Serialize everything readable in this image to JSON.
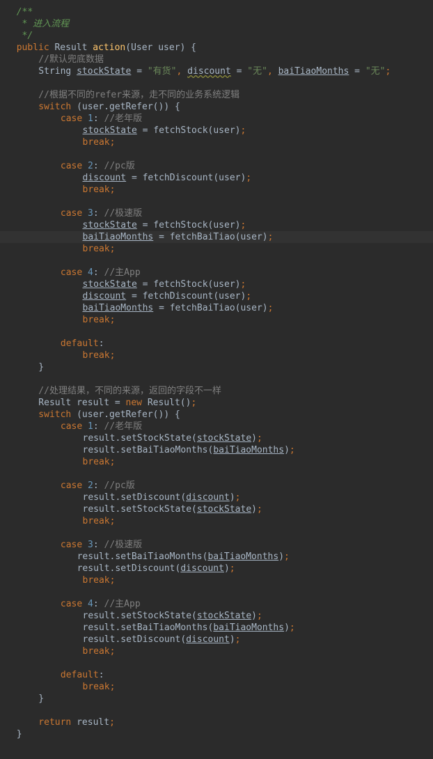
{
  "editor": {
    "background": "#2b2b2b",
    "highlight_line_color": "#323232",
    "colors": {
      "comment": "#629755",
      "line_comment": "#808080",
      "keyword": "#cc7832",
      "number": "#6897bb",
      "string": "#6a8759",
      "method": "#ffc66d",
      "text": "#a9b7c6"
    },
    "lines": [
      {
        "col": 3,
        "hl": false,
        "tokens": [
          {
            "t": "/**",
            "c": "comment"
          }
        ]
      },
      {
        "col": 3,
        "hl": false,
        "tokens": [
          {
            "t": " * 进入流程",
            "c": "comment"
          }
        ]
      },
      {
        "col": 3,
        "hl": false,
        "tokens": [
          {
            "t": " */",
            "c": "comment"
          }
        ]
      },
      {
        "col": 3,
        "hl": false,
        "tokens": [
          {
            "t": "public ",
            "c": "keyword"
          },
          {
            "t": "Result ",
            "c": "plain"
          },
          {
            "t": "action",
            "c": "method"
          },
          {
            "t": "(User user) {",
            "c": "plain"
          }
        ]
      },
      {
        "col": 7,
        "hl": false,
        "tokens": [
          {
            "t": "//默认兜底数据",
            "c": "linecomment"
          }
        ]
      },
      {
        "col": 7,
        "hl": false,
        "tokens": [
          {
            "t": "String ",
            "c": "plain"
          },
          {
            "t": "stockState",
            "c": "var"
          },
          {
            "t": " = ",
            "c": "plain"
          },
          {
            "t": "\"有货\"",
            "c": "string"
          },
          {
            "t": ", ",
            "c": "keyword"
          },
          {
            "t": "discount",
            "c": "warnvar"
          },
          {
            "t": " = ",
            "c": "plain"
          },
          {
            "t": "\"无\"",
            "c": "string"
          },
          {
            "t": ", ",
            "c": "keyword"
          },
          {
            "t": "baiTiaoMonths",
            "c": "var"
          },
          {
            "t": " = ",
            "c": "plain"
          },
          {
            "t": "\"无\"",
            "c": "string"
          },
          {
            "t": ";",
            "c": "keyword"
          }
        ]
      },
      {
        "col": 0,
        "hl": false,
        "tokens": []
      },
      {
        "col": 7,
        "hl": false,
        "tokens": [
          {
            "t": "//根据不同的refer来源，走不同的业务系统逻辑",
            "c": "linecomment"
          }
        ]
      },
      {
        "col": 7,
        "hl": false,
        "tokens": [
          {
            "t": "switch ",
            "c": "keyword"
          },
          {
            "t": "(user.getRefer()) {",
            "c": "plain"
          }
        ]
      },
      {
        "col": 11,
        "hl": false,
        "tokens": [
          {
            "t": "case ",
            "c": "keyword"
          },
          {
            "t": "1",
            "c": "number"
          },
          {
            "t": ": ",
            "c": "plain"
          },
          {
            "t": "//老年版",
            "c": "linecomment"
          }
        ]
      },
      {
        "col": 15,
        "hl": false,
        "tokens": [
          {
            "t": "stockState",
            "c": "var"
          },
          {
            "t": " = fetchStock(user)",
            "c": "plain"
          },
          {
            "t": ";",
            "c": "keyword"
          }
        ]
      },
      {
        "col": 15,
        "hl": false,
        "tokens": [
          {
            "t": "break;",
            "c": "keyword"
          }
        ]
      },
      {
        "col": 0,
        "hl": false,
        "tokens": []
      },
      {
        "col": 11,
        "hl": false,
        "tokens": [
          {
            "t": "case ",
            "c": "keyword"
          },
          {
            "t": "2",
            "c": "number"
          },
          {
            "t": ": ",
            "c": "plain"
          },
          {
            "t": "//pc版",
            "c": "linecomment"
          }
        ]
      },
      {
        "col": 15,
        "hl": false,
        "tokens": [
          {
            "t": "discount",
            "c": "var"
          },
          {
            "t": " = fetchDiscount(user)",
            "c": "plain"
          },
          {
            "t": ";",
            "c": "keyword"
          }
        ]
      },
      {
        "col": 15,
        "hl": false,
        "tokens": [
          {
            "t": "break;",
            "c": "keyword"
          }
        ]
      },
      {
        "col": 0,
        "hl": false,
        "tokens": []
      },
      {
        "col": 11,
        "hl": false,
        "tokens": [
          {
            "t": "case ",
            "c": "keyword"
          },
          {
            "t": "3",
            "c": "number"
          },
          {
            "t": ": ",
            "c": "plain"
          },
          {
            "t": "//极速版",
            "c": "linecomment"
          }
        ]
      },
      {
        "col": 15,
        "hl": false,
        "tokens": [
          {
            "t": "stockState",
            "c": "var"
          },
          {
            "t": " = fetchStock(user)",
            "c": "plain"
          },
          {
            "t": ";",
            "c": "keyword"
          }
        ]
      },
      {
        "col": 15,
        "hl": true,
        "tokens": [
          {
            "t": "baiTiaoMonths",
            "c": "var"
          },
          {
            "t": " = fetchBaiTiao(user)",
            "c": "plain"
          },
          {
            "t": ";",
            "c": "keyword"
          }
        ]
      },
      {
        "col": 15,
        "hl": false,
        "tokens": [
          {
            "t": "break;",
            "c": "keyword"
          }
        ]
      },
      {
        "col": 0,
        "hl": false,
        "tokens": []
      },
      {
        "col": 11,
        "hl": false,
        "tokens": [
          {
            "t": "case ",
            "c": "keyword"
          },
          {
            "t": "4",
            "c": "number"
          },
          {
            "t": ": ",
            "c": "plain"
          },
          {
            "t": "//主App",
            "c": "linecomment"
          }
        ]
      },
      {
        "col": 15,
        "hl": false,
        "tokens": [
          {
            "t": "stockState",
            "c": "var"
          },
          {
            "t": " = fetchStock(user)",
            "c": "plain"
          },
          {
            "t": ";",
            "c": "keyword"
          }
        ]
      },
      {
        "col": 15,
        "hl": false,
        "tokens": [
          {
            "t": "discount",
            "c": "var"
          },
          {
            "t": " = fetchDiscount(user)",
            "c": "plain"
          },
          {
            "t": ";",
            "c": "keyword"
          }
        ]
      },
      {
        "col": 15,
        "hl": false,
        "tokens": [
          {
            "t": "baiTiaoMonths",
            "c": "var"
          },
          {
            "t": " = fetchBaiTiao(user)",
            "c": "plain"
          },
          {
            "t": ";",
            "c": "keyword"
          }
        ]
      },
      {
        "col": 15,
        "hl": false,
        "tokens": [
          {
            "t": "break;",
            "c": "keyword"
          }
        ]
      },
      {
        "col": 0,
        "hl": false,
        "tokens": []
      },
      {
        "col": 11,
        "hl": false,
        "tokens": [
          {
            "t": "default",
            "c": "keyword"
          },
          {
            "t": ":",
            "c": "plain"
          }
        ]
      },
      {
        "col": 15,
        "hl": false,
        "tokens": [
          {
            "t": "break;",
            "c": "keyword"
          }
        ]
      },
      {
        "col": 7,
        "hl": false,
        "tokens": [
          {
            "t": "}",
            "c": "plain"
          }
        ]
      },
      {
        "col": 0,
        "hl": false,
        "tokens": []
      },
      {
        "col": 7,
        "hl": false,
        "tokens": [
          {
            "t": "//处理结果，不同的来源，返回的字段不一样",
            "c": "linecomment"
          }
        ]
      },
      {
        "col": 7,
        "hl": false,
        "tokens": [
          {
            "t": "Result result = ",
            "c": "plain"
          },
          {
            "t": "new ",
            "c": "keyword"
          },
          {
            "t": "Result()",
            "c": "plain"
          },
          {
            "t": ";",
            "c": "keyword"
          }
        ]
      },
      {
        "col": 7,
        "hl": false,
        "tokens": [
          {
            "t": "switch ",
            "c": "keyword"
          },
          {
            "t": "(user.getRefer()) {",
            "c": "plain"
          }
        ]
      },
      {
        "col": 11,
        "hl": false,
        "tokens": [
          {
            "t": "case ",
            "c": "keyword"
          },
          {
            "t": "1",
            "c": "number"
          },
          {
            "t": ": ",
            "c": "plain"
          },
          {
            "t": "//老年版",
            "c": "linecomment"
          }
        ]
      },
      {
        "col": 15,
        "hl": false,
        "tokens": [
          {
            "t": "result.setStockState(",
            "c": "plain"
          },
          {
            "t": "stockState",
            "c": "var"
          },
          {
            "t": ")",
            "c": "plain"
          },
          {
            "t": ";",
            "c": "keyword"
          }
        ]
      },
      {
        "col": 15,
        "hl": false,
        "tokens": [
          {
            "t": "result.setBaiTiaoMonths(",
            "c": "plain"
          },
          {
            "t": "baiTiaoMonths",
            "c": "var"
          },
          {
            "t": ")",
            "c": "plain"
          },
          {
            "t": ";",
            "c": "keyword"
          }
        ]
      },
      {
        "col": 15,
        "hl": false,
        "tokens": [
          {
            "t": "break;",
            "c": "keyword"
          }
        ]
      },
      {
        "col": 0,
        "hl": false,
        "tokens": []
      },
      {
        "col": 11,
        "hl": false,
        "tokens": [
          {
            "t": "case ",
            "c": "keyword"
          },
          {
            "t": "2",
            "c": "number"
          },
          {
            "t": ": ",
            "c": "plain"
          },
          {
            "t": "//pc版",
            "c": "linecomment"
          }
        ]
      },
      {
        "col": 15,
        "hl": false,
        "tokens": [
          {
            "t": "result.setDiscount(",
            "c": "plain"
          },
          {
            "t": "discount",
            "c": "var"
          },
          {
            "t": ")",
            "c": "plain"
          },
          {
            "t": ";",
            "c": "keyword"
          }
        ]
      },
      {
        "col": 15,
        "hl": false,
        "tokens": [
          {
            "t": "result.setStockState(",
            "c": "plain"
          },
          {
            "t": "stockState",
            "c": "var"
          },
          {
            "t": ")",
            "c": "plain"
          },
          {
            "t": ";",
            "c": "keyword"
          }
        ]
      },
      {
        "col": 15,
        "hl": false,
        "tokens": [
          {
            "t": "break;",
            "c": "keyword"
          }
        ]
      },
      {
        "col": 0,
        "hl": false,
        "tokens": []
      },
      {
        "col": 11,
        "hl": false,
        "tokens": [
          {
            "t": "case ",
            "c": "keyword"
          },
          {
            "t": "3",
            "c": "number"
          },
          {
            "t": ": ",
            "c": "plain"
          },
          {
            "t": "//极速版",
            "c": "linecomment"
          }
        ]
      },
      {
        "col": 14,
        "hl": false,
        "tokens": [
          {
            "t": "result.setBaiTiaoMonths(",
            "c": "plain"
          },
          {
            "t": "baiTiaoMonths",
            "c": "var"
          },
          {
            "t": ")",
            "c": "plain"
          },
          {
            "t": ";",
            "c": "keyword"
          }
        ]
      },
      {
        "col": 14,
        "hl": false,
        "tokens": [
          {
            "t": "result.setDiscount(",
            "c": "plain"
          },
          {
            "t": "discount",
            "c": "var"
          },
          {
            "t": ")",
            "c": "plain"
          },
          {
            "t": ";",
            "c": "keyword"
          }
        ]
      },
      {
        "col": 15,
        "hl": false,
        "tokens": [
          {
            "t": "break;",
            "c": "keyword"
          }
        ]
      },
      {
        "col": 0,
        "hl": false,
        "tokens": []
      },
      {
        "col": 11,
        "hl": false,
        "tokens": [
          {
            "t": "case ",
            "c": "keyword"
          },
          {
            "t": "4",
            "c": "number"
          },
          {
            "t": ": ",
            "c": "plain"
          },
          {
            "t": "//主App",
            "c": "linecomment"
          }
        ]
      },
      {
        "col": 15,
        "hl": false,
        "tokens": [
          {
            "t": "result.setStockState(",
            "c": "plain"
          },
          {
            "t": "stockState",
            "c": "var"
          },
          {
            "t": ")",
            "c": "plain"
          },
          {
            "t": ";",
            "c": "keyword"
          }
        ]
      },
      {
        "col": 15,
        "hl": false,
        "tokens": [
          {
            "t": "result.setBaiTiaoMonths(",
            "c": "plain"
          },
          {
            "t": "baiTiaoMonths",
            "c": "var"
          },
          {
            "t": ")",
            "c": "plain"
          },
          {
            "t": ";",
            "c": "keyword"
          }
        ]
      },
      {
        "col": 15,
        "hl": false,
        "tokens": [
          {
            "t": "result.setDiscount(",
            "c": "plain"
          },
          {
            "t": "discount",
            "c": "var"
          },
          {
            "t": ")",
            "c": "plain"
          },
          {
            "t": ";",
            "c": "keyword"
          }
        ]
      },
      {
        "col": 15,
        "hl": false,
        "tokens": [
          {
            "t": "break;",
            "c": "keyword"
          }
        ]
      },
      {
        "col": 0,
        "hl": false,
        "tokens": []
      },
      {
        "col": 11,
        "hl": false,
        "tokens": [
          {
            "t": "default",
            "c": "keyword"
          },
          {
            "t": ":",
            "c": "plain"
          }
        ]
      },
      {
        "col": 15,
        "hl": false,
        "tokens": [
          {
            "t": "break;",
            "c": "keyword"
          }
        ]
      },
      {
        "col": 7,
        "hl": false,
        "tokens": [
          {
            "t": "}",
            "c": "plain"
          }
        ]
      },
      {
        "col": 0,
        "hl": false,
        "tokens": []
      },
      {
        "col": 7,
        "hl": false,
        "tokens": [
          {
            "t": "return ",
            "c": "keyword"
          },
          {
            "t": "result",
            "c": "plain"
          },
          {
            "t": ";",
            "c": "keyword"
          }
        ]
      },
      {
        "col": 3,
        "hl": false,
        "tokens": [
          {
            "t": "}",
            "c": "plain"
          }
        ]
      }
    ]
  }
}
